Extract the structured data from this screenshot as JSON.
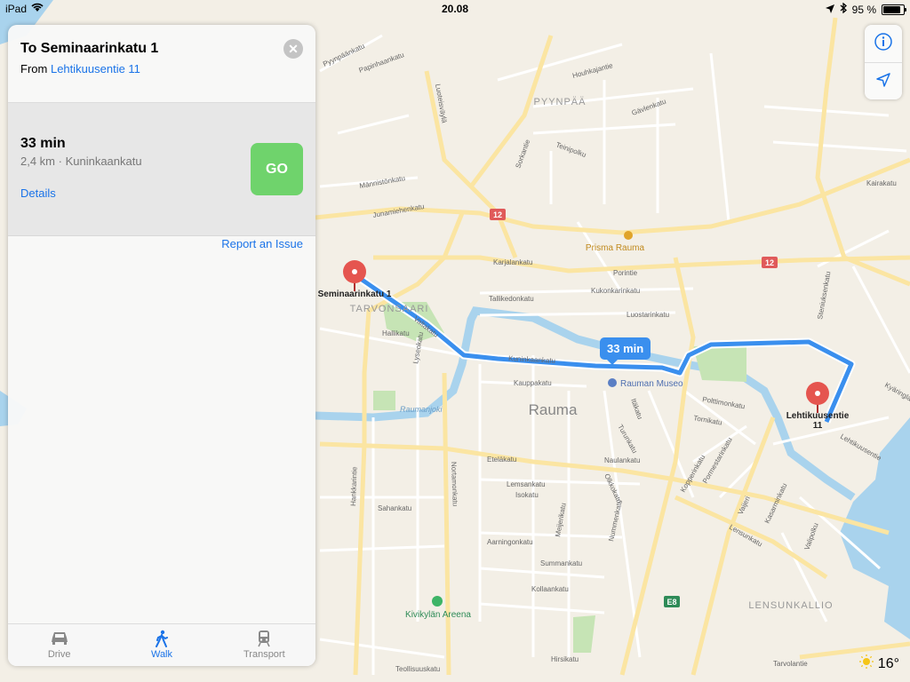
{
  "status": {
    "device": "iPad",
    "time": "20.08",
    "battery": "95 %",
    "battery_level": 0.95
  },
  "panel": {
    "title": "To Seminaarinkatu 1",
    "from_label": "From",
    "from_value": "Lehtikuusentie 11",
    "route_time": "33 min",
    "route_info": "2,4 km · Kuninkaankatu",
    "details": "Details",
    "go": "GO",
    "report": "Report an Issue"
  },
  "tabs": [
    {
      "label": "Drive",
      "icon": "car-icon"
    },
    {
      "label": "Walk",
      "icon": "walk-icon",
      "active": true
    },
    {
      "label": "Transport",
      "icon": "train-icon"
    }
  ],
  "map": {
    "eta": "33 min",
    "start_pin": "Seminaarinkatu 1",
    "end_pin_line1": "Lehtikuusentie",
    "end_pin_line2": "11",
    "city": "Rauma",
    "districts": [
      "PYYNPÄÄ",
      "TARVONSAARI",
      "LENSUNKALLIO"
    ],
    "pois": [
      "Prisma Rauma",
      "Rauman Museo",
      "Kivikylän Areena"
    ],
    "river": "Raumanjoki",
    "road_shield": "12",
    "road_shield_e": "E8",
    "streets": [
      "Karjalankatu",
      "Porintie",
      "Kukonkarinkatu",
      "Tallikedonkatu",
      "Luostarinkatu",
      "Kuninkaankatu",
      "Valtakatu",
      "Kauppakatu",
      "Eteläkatu",
      "Nortamonkatu",
      "Polttimonkatu",
      "Tornikatu",
      "Naulankatu",
      "Lensunkatu",
      "Lehtikuusentie",
      "Kairakatu",
      "Junamiehenkatu",
      "Männistönkatu",
      "Sorkantie",
      "Luoteisväylä",
      "Pyynpäänkatu",
      "Papinhaankatu",
      "Houhkajantie",
      "Teinipolku",
      "Gävlenkatu",
      "Hallikatu",
      "Lyseokatu",
      "Sahankatu",
      "Lemsankatu",
      "Isokatu",
      "Aarningonkatu",
      "Summankatu",
      "Kollaankatu",
      "Meijerikatu",
      "Nummenkatu",
      "Teollisuuskatu",
      "Hirsikatu",
      "Tarvolantie",
      "Hankkarintie",
      "Turunkatu",
      "Itäkatu",
      "Olkkokatu",
      "Pormestarinkatu",
      "Vaijeri",
      "Kasarminkatu",
      "Valipolku",
      "Steniuksenkatu",
      "Kyäringlanti",
      "Kopperinkatu"
    ],
    "temperature": "16°"
  }
}
